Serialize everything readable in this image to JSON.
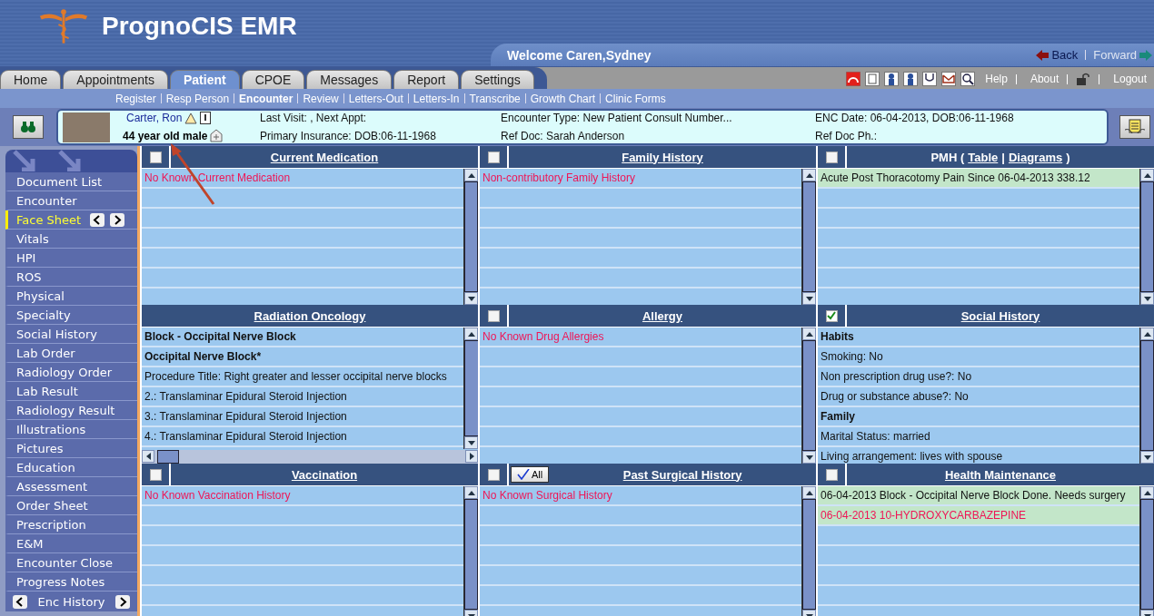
{
  "header": {
    "title": "PrognoCIS EMR",
    "welcome": "Welcome Caren,Sydney",
    "back": {
      "label": "Back",
      "disabled": false
    },
    "forward": {
      "label": "Forward",
      "disabled": true
    }
  },
  "tabs": [
    {
      "label": "Home",
      "selected": false
    },
    {
      "label": "Appointments",
      "selected": false
    },
    {
      "label": "Patient",
      "selected": true
    },
    {
      "label": "CPOE",
      "selected": false
    },
    {
      "label": "Messages",
      "selected": false
    },
    {
      "label": "Report",
      "selected": false
    },
    {
      "label": "Settings",
      "selected": false
    }
  ],
  "utility_links": [
    "Help",
    "About",
    "Logout"
  ],
  "subnav": [
    {
      "label": "Register",
      "selected": false
    },
    {
      "label": "Resp Person",
      "selected": false
    },
    {
      "label": "Encounter",
      "selected": true
    },
    {
      "label": "Review",
      "selected": false
    },
    {
      "label": "Letters-Out",
      "selected": false
    },
    {
      "label": "Letters-In",
      "selected": false
    },
    {
      "label": "Transcribe",
      "selected": false
    },
    {
      "label": "Growth Chart",
      "selected": false
    },
    {
      "label": "Clinic Forms",
      "selected": false
    }
  ],
  "patient": {
    "name": "Carter, Ron",
    "summary": "44 year old male",
    "fields": [
      "Last Visit: , Next Appt:",
      "Primary Insurance: DOB:06-11-1968",
      "Encounter Type: New Patient Consult Number...",
      "Ref Doc: Sarah Anderson",
      "ENC Date: 06-04-2013, DOB:06-11-1968",
      "Ref Doc Ph.:"
    ]
  },
  "sidebar": {
    "items": [
      {
        "label": "Document List",
        "selected": false
      },
      {
        "label": "Encounter",
        "selected": false
      },
      {
        "label": "Face Sheet",
        "selected": true
      },
      {
        "label": "Vitals",
        "selected": false
      },
      {
        "label": "HPI",
        "selected": false
      },
      {
        "label": "ROS",
        "selected": false
      },
      {
        "label": "Physical",
        "selected": false
      },
      {
        "label": "Specialty",
        "selected": false
      },
      {
        "label": "Social History",
        "selected": false
      },
      {
        "label": "Lab Order",
        "selected": false
      },
      {
        "label": "Radiology Order",
        "selected": false
      },
      {
        "label": "Lab Result",
        "selected": false
      },
      {
        "label": "Radiology Result",
        "selected": false
      },
      {
        "label": "Illustrations",
        "selected": false
      },
      {
        "label": "Pictures",
        "selected": false
      },
      {
        "label": "Education",
        "selected": false
      },
      {
        "label": "Assessment",
        "selected": false
      },
      {
        "label": "Order Sheet",
        "selected": false
      },
      {
        "label": "Prescription",
        "selected": false
      },
      {
        "label": "E&M",
        "selected": false
      },
      {
        "label": "Encounter Close",
        "selected": false
      },
      {
        "label": "Progress Notes",
        "selected": false
      }
    ],
    "footer": "Enc History"
  },
  "panels": [
    {
      "title_parts": [
        {
          "text": "Current Medication",
          "kind": "link"
        }
      ],
      "checkbox": {
        "checked": false
      },
      "rows": [
        {
          "text": "No Known Current Medication",
          "kind": "warning",
          "highlighted": false
        }
      ]
    },
    {
      "title_parts": [
        {
          "text": "Family History",
          "kind": "link"
        }
      ],
      "checkbox": {
        "checked": false
      },
      "rows": [
        {
          "text": "Non-contributory Family History",
          "kind": "warning",
          "highlighted": false
        }
      ]
    },
    {
      "title_parts": [
        {
          "text": "PMH (",
          "kind": "plain"
        },
        {
          "text": "Table",
          "kind": "link"
        },
        {
          "text": "|",
          "kind": "plain"
        },
        {
          "text": "Diagrams",
          "kind": "link"
        },
        {
          "text": ")",
          "kind": "plain"
        }
      ],
      "checkbox": {
        "checked": false
      },
      "rows": [
        {
          "text": "Acute Post Thoracotomy Pain Since 06-04-2013 338.12",
          "kind": "entry",
          "highlighted": true
        }
      ]
    },
    {
      "title_parts": [
        {
          "text": "Radiation Oncology",
          "kind": "link"
        }
      ],
      "hscroll": true,
      "rows": [
        {
          "text": "Block - Occipital Nerve Block",
          "kind": "heading",
          "highlighted": false
        },
        {
          "text": "Occipital Nerve Block*",
          "kind": "heading",
          "highlighted": false
        },
        {
          "text": "Procedure Title: Right greater and lesser occipital nerve blocks",
          "kind": "entry",
          "highlighted": false
        },
        {
          "text": "2.: Translaminar Epidural Steroid Injection",
          "kind": "entry",
          "highlighted": false
        },
        {
          "text": "3.: Translaminar Epidural Steroid Injection",
          "kind": "entry",
          "highlighted": false
        },
        {
          "text": "4.: Translaminar Epidural Steroid Injection",
          "kind": "entry",
          "highlighted": false
        }
      ]
    },
    {
      "title_parts": [
        {
          "text": "Allergy",
          "kind": "link"
        }
      ],
      "checkbox": {
        "checked": false
      },
      "rows": [
        {
          "text": "No Known Drug Allergies",
          "kind": "warning",
          "highlighted": false
        }
      ]
    },
    {
      "title_parts": [
        {
          "text": "Social History",
          "kind": "link"
        }
      ],
      "checkbox": {
        "checked": true
      },
      "rows": [
        {
          "text": "Habits",
          "kind": "heading",
          "highlighted": false
        },
        {
          "text": "Smoking: No",
          "kind": "entry",
          "highlighted": false
        },
        {
          "text": "Non prescription drug use?: No",
          "kind": "entry",
          "highlighted": false
        },
        {
          "text": "Drug or substance abuse?: No",
          "kind": "entry",
          "highlighted": false
        },
        {
          "text": "Family",
          "kind": "heading",
          "highlighted": false
        },
        {
          "text": "Marital Status: married",
          "kind": "entry",
          "highlighted": false
        },
        {
          "text": "Living arrangement: lives with spouse",
          "kind": "entry",
          "highlighted": false
        }
      ]
    },
    {
      "title_parts": [
        {
          "text": "Vaccination",
          "kind": "link"
        }
      ],
      "checkbox": {
        "checked": false
      },
      "rows": [
        {
          "text": "No Known Vaccination History",
          "kind": "warning",
          "highlighted": false
        }
      ]
    },
    {
      "title_parts": [
        {
          "text": "Past Surgical History",
          "kind": "link"
        }
      ],
      "checkbox": {
        "checked": false
      },
      "select_all": "All",
      "rows": [
        {
          "text": "No Known Surgical History",
          "kind": "warning",
          "highlighted": false
        }
      ]
    },
    {
      "title_parts": [
        {
          "text": "Health Maintenance",
          "kind": "link"
        }
      ],
      "checkbox": {
        "checked": false
      },
      "rows": [
        {
          "text": "06-04-2013 Block - Occipital Nerve Block Done. Needs surgery",
          "kind": "entry",
          "highlighted": true
        },
        {
          "text": "06-04-2013 10-HYDROXYCARBAZEPINE",
          "kind": "warning",
          "highlighted": true
        }
      ]
    }
  ]
}
